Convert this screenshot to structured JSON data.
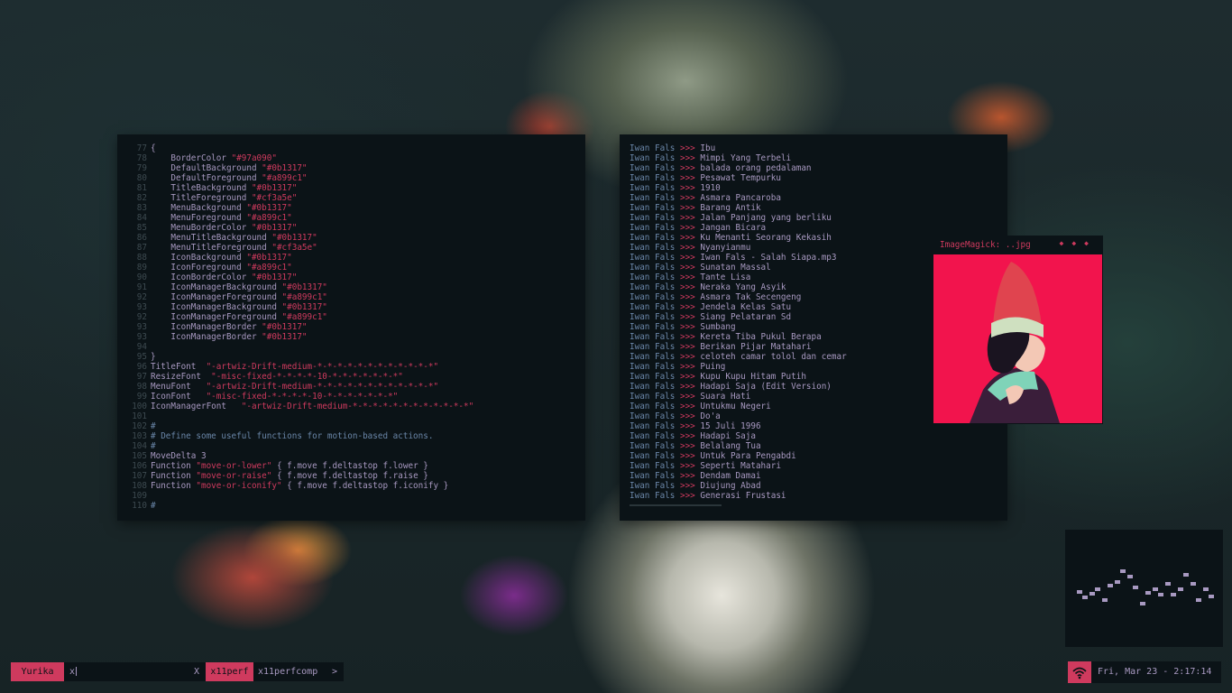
{
  "colors": {
    "bg": "#0b1317",
    "accent": "#cf3a5e",
    "fg": "#a899c1",
    "comment": "#6a86a8",
    "line_number": "#3d4a50"
  },
  "editor": {
    "lines": [
      {
        "n": "77",
        "parts": [
          [
            "tx",
            "{"
          ]
        ]
      },
      {
        "n": "78",
        "parts": [
          [
            "tx",
            "    BorderColor "
          ],
          [
            "str",
            "\"#97a090\""
          ]
        ]
      },
      {
        "n": "79",
        "parts": [
          [
            "tx",
            "    DefaultBackground "
          ],
          [
            "str",
            "\"#0b1317\""
          ]
        ]
      },
      {
        "n": "80",
        "parts": [
          [
            "tx",
            "    DefaultForeground "
          ],
          [
            "str",
            "\"#a899c1\""
          ]
        ]
      },
      {
        "n": "81",
        "parts": [
          [
            "tx",
            "    TitleBackground "
          ],
          [
            "str",
            "\"#0b1317\""
          ]
        ]
      },
      {
        "n": "82",
        "parts": [
          [
            "tx",
            "    TitleForeground "
          ],
          [
            "str",
            "\"#cf3a5e\""
          ]
        ]
      },
      {
        "n": "83",
        "parts": [
          [
            "tx",
            "    MenuBackground "
          ],
          [
            "str",
            "\"#0b1317\""
          ]
        ]
      },
      {
        "n": "84",
        "parts": [
          [
            "tx",
            "    MenuForeground "
          ],
          [
            "str",
            "\"#a899c1\""
          ]
        ]
      },
      {
        "n": "85",
        "parts": [
          [
            "tx",
            "    MenuBorderColor "
          ],
          [
            "str",
            "\"#0b1317\""
          ]
        ]
      },
      {
        "n": "86",
        "parts": [
          [
            "tx",
            "    MenuTitleBackground "
          ],
          [
            "str",
            "\"#0b1317\""
          ]
        ]
      },
      {
        "n": "87",
        "parts": [
          [
            "tx",
            "    MenuTitleForeground "
          ],
          [
            "str",
            "\"#cf3a5e\""
          ]
        ]
      },
      {
        "n": "88",
        "parts": [
          [
            "tx",
            "    IconBackground "
          ],
          [
            "str",
            "\"#0b1317\""
          ]
        ]
      },
      {
        "n": "89",
        "parts": [
          [
            "tx",
            "    IconForeground "
          ],
          [
            "str",
            "\"#a899c1\""
          ]
        ]
      },
      {
        "n": "90",
        "parts": [
          [
            "tx",
            "    IconBorderColor "
          ],
          [
            "str",
            "\"#0b1317\""
          ]
        ]
      },
      {
        "n": "91",
        "parts": [
          [
            "tx",
            "    IconManagerBackground "
          ],
          [
            "str",
            "\"#0b1317\""
          ]
        ]
      },
      {
        "n": "92",
        "parts": [
          [
            "tx",
            "    IconManagerForeground "
          ],
          [
            "str",
            "\"#a899c1\""
          ]
        ]
      },
      {
        "n": "93",
        "parts": [
          [
            "tx",
            "    IconManagerBackground "
          ],
          [
            "str",
            "\"#0b1317\""
          ]
        ]
      },
      {
        "n": "92",
        "parts": [
          [
            "tx",
            "    IconManagerForeground "
          ],
          [
            "str",
            "\"#a899c1\""
          ]
        ]
      },
      {
        "n": "93",
        "parts": [
          [
            "tx",
            "    IconManagerBorder "
          ],
          [
            "str",
            "\"#0b1317\""
          ]
        ]
      },
      {
        "n": "93",
        "parts": [
          [
            "tx",
            "    IconManagerBorder "
          ],
          [
            "str",
            "\"#0b1317\""
          ]
        ]
      },
      {
        "n": "94",
        "parts": []
      },
      {
        "n": "95",
        "parts": [
          [
            "tx",
            "}"
          ]
        ]
      },
      {
        "n": "96",
        "parts": [
          [
            "tx",
            "TitleFont  "
          ],
          [
            "str",
            "\"-artwiz-Drift-medium-*-*-*-*-*-*-*-*-*-*-*-*\""
          ]
        ]
      },
      {
        "n": "97",
        "parts": [
          [
            "tx",
            "ResizeFont  "
          ],
          [
            "str",
            "\"-misc-fixed-*-*-*-*-10-*-*-*-*-*-*-*\""
          ]
        ]
      },
      {
        "n": "98",
        "parts": [
          [
            "tx",
            "MenuFont   "
          ],
          [
            "str",
            "\"-artwiz-Drift-medium-*-*-*-*-*-*-*-*-*-*-*-*\""
          ]
        ]
      },
      {
        "n": "99",
        "parts": [
          [
            "tx",
            "IconFont   "
          ],
          [
            "str",
            "\"-misc-fixed-*-*-*-*-10-*-*-*-*-*-*-*\""
          ]
        ]
      },
      {
        "n": "100",
        "parts": [
          [
            "tx",
            "IconManagerFont   "
          ],
          [
            "str",
            "\"-artwiz-Drift-medium-*-*-*-*-*-*-*-*-*-*-*-*\""
          ]
        ]
      },
      {
        "n": "101",
        "parts": []
      },
      {
        "n": "102",
        "parts": [
          [
            "cmt",
            "#"
          ]
        ]
      },
      {
        "n": "103",
        "parts": [
          [
            "cmt",
            "# Define some useful functions for motion-based actions."
          ]
        ]
      },
      {
        "n": "104",
        "parts": [
          [
            "cmt",
            "#"
          ]
        ]
      },
      {
        "n": "105",
        "parts": [
          [
            "tx",
            "MoveDelta 3"
          ]
        ]
      },
      {
        "n": "106",
        "parts": [
          [
            "tx",
            "Function "
          ],
          [
            "str",
            "\"move-or-lower\""
          ],
          [
            "tx",
            " { f.move f.deltastop f.lower }"
          ]
        ]
      },
      {
        "n": "107",
        "parts": [
          [
            "tx",
            "Function "
          ],
          [
            "str",
            "\"move-or-raise\""
          ],
          [
            "tx",
            " { f.move f.deltastop f.raise }"
          ]
        ]
      },
      {
        "n": "108",
        "parts": [
          [
            "tx",
            "Function "
          ],
          [
            "str",
            "\"move-or-iconify\""
          ],
          [
            "tx",
            " { f.move f.deltastop f.iconify }"
          ]
        ]
      },
      {
        "n": "109",
        "parts": []
      },
      {
        "n": "110",
        "parts": [
          [
            "cmt",
            "#"
          ]
        ]
      }
    ]
  },
  "playlist": {
    "separator": ">>>",
    "items": [
      {
        "artist": "Iwan Fals",
        "title": "Ibu"
      },
      {
        "artist": "Iwan Fals",
        "title": "Mimpi Yang Terbeli"
      },
      {
        "artist": "Iwan Fals",
        "title": "balada orang pedalaman"
      },
      {
        "artist": "Iwan Fals",
        "title": "Pesawat Tempurku"
      },
      {
        "artist": "Iwan Fals",
        "title": "1910"
      },
      {
        "artist": "Iwan Fals",
        "title": "Asmara Pancaroba"
      },
      {
        "artist": "Iwan Fals",
        "title": "Barang Antik"
      },
      {
        "artist": "Iwan Fals",
        "title": "Jalan Panjang yang berliku"
      },
      {
        "artist": "Iwan Fals",
        "title": "Jangan Bicara"
      },
      {
        "artist": "Iwan Fals",
        "title": "Ku Menanti Seorang Kekasih"
      },
      {
        "artist": "Iwan Fals",
        "title": "Nyanyianmu"
      },
      {
        "artist": "Iwan Fals",
        "title": "Iwan Fals - Salah Siapa.mp3"
      },
      {
        "artist": "Iwan Fals",
        "title": "Sunatan Massal"
      },
      {
        "artist": "Iwan Fals",
        "title": "Tante Lisa"
      },
      {
        "artist": "Iwan Fals",
        "title": "Neraka Yang Asyik"
      },
      {
        "artist": "Iwan Fals",
        "title": "Asmara Tak Secengeng"
      },
      {
        "artist": "Iwan Fals",
        "title": "Jendela Kelas Satu"
      },
      {
        "artist": "Iwan Fals",
        "title": "Siang Pelataran Sd"
      },
      {
        "artist": "Iwan Fals",
        "title": "Sumbang"
      },
      {
        "artist": "Iwan Fals",
        "title": "Kereta Tiba Pukul Berapa"
      },
      {
        "artist": "Iwan Fals",
        "title": "Berikan Pijar Matahari"
      },
      {
        "artist": "Iwan Fals",
        "title": "celoteh camar tolol dan cemar"
      },
      {
        "artist": "Iwan Fals",
        "title": "Puing"
      },
      {
        "artist": "Iwan Fals",
        "title": "Kupu Kupu Hitam Putih"
      },
      {
        "artist": "Iwan Fals",
        "title": "Hadapi Saja (Edit Version)"
      },
      {
        "artist": "Iwan Fals",
        "title": "Suara Hati"
      },
      {
        "artist": "Iwan Fals",
        "title": "Untukmu Negeri"
      },
      {
        "artist": "Iwan Fals",
        "title": "Do'a"
      },
      {
        "artist": "Iwan Fals",
        "title": "15 Juli 1996"
      },
      {
        "artist": "Iwan Fals",
        "title": "Hadapi Saja"
      },
      {
        "artist": "Iwan Fals",
        "title": "Belalang Tua"
      },
      {
        "artist": "Iwan Fals",
        "title": "Untuk Para Pengabdi"
      },
      {
        "artist": "Iwan Fals",
        "title": "Seperti Matahari"
      },
      {
        "artist": "Iwan Fals",
        "title": "Dendam Damai"
      },
      {
        "artist": "Iwan Fals",
        "title": "Diujung Abad"
      },
      {
        "artist": "Iwan Fals",
        "title": "Generasi Frustasi"
      }
    ]
  },
  "image_viewer": {
    "title": "ImageMagick: ..jpg",
    "buttons": [
      "◆",
      "◆",
      "◆"
    ],
    "icon": "illustration-image"
  },
  "bar": {
    "workspace": "Yurika",
    "prompt_value": "x",
    "prompt_close": "X",
    "suggestion_selected": "x11perf",
    "suggestion_other": "x11perfcomp",
    "more_arrow": ">",
    "wifi_icon": "wifi-icon",
    "clock": "Fri, Mar 23 - 2:17:14"
  }
}
